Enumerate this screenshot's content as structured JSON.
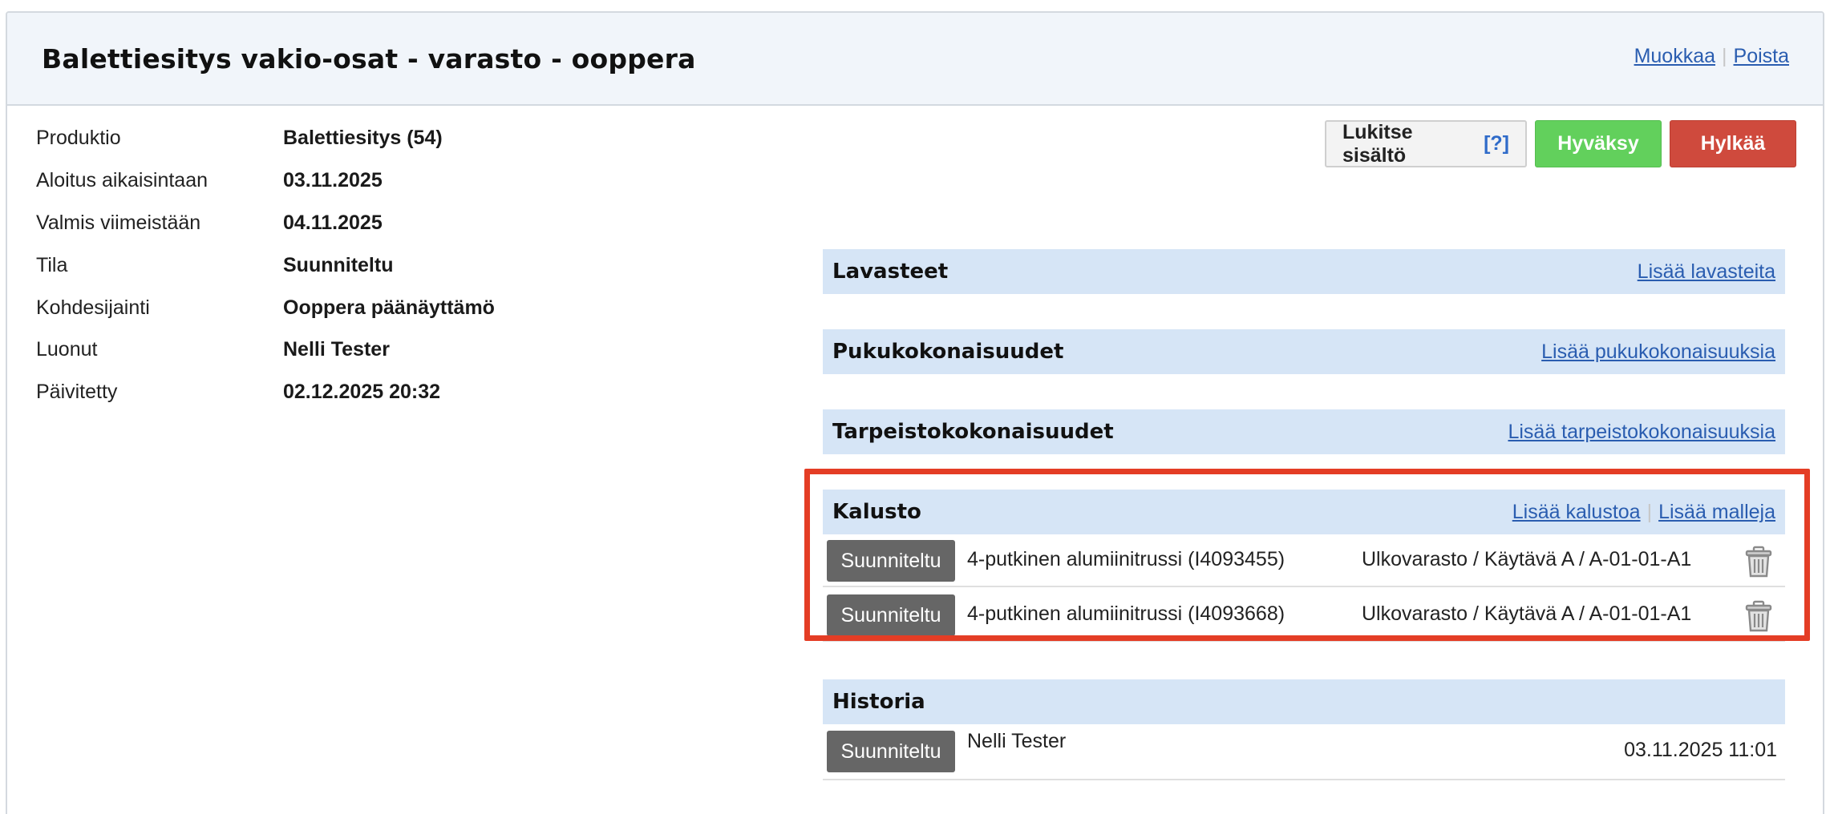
{
  "header": {
    "title": "Balettiesitys vakio-osat - varasto - ooppera",
    "edit_link": "Muokkaa",
    "delete_link": "Poista",
    "separator": "|"
  },
  "info": [
    {
      "label": "Produktio",
      "value": "Balettiesitys (54)"
    },
    {
      "label": "Aloitus aikaisintaan",
      "value": "03.11.2025"
    },
    {
      "label": "Valmis viimeistään",
      "value": "04.11.2025"
    },
    {
      "label": "Tila",
      "value": "Suunniteltu"
    },
    {
      "label": "Kohdesijainti",
      "value": "Ooppera päänäyttämö"
    },
    {
      "label": "Luonut",
      "value": "Nelli Tester"
    },
    {
      "label": "Päivitetty",
      "value": "02.12.2025 20:32"
    }
  ],
  "actions": {
    "lock_label": "Lukitse sisältö",
    "lock_help": "[?]",
    "approve_label": "Hyväksy",
    "reject_label": "Hylkää"
  },
  "sections": {
    "lavasteet": {
      "title": "Lavasteet",
      "link": "Lisää lavasteita"
    },
    "puvut": {
      "title": "Pukukokonaisuudet",
      "link": "Lisää pukukokonaisuuksia"
    },
    "tarpeisto": {
      "title": "Tarpeistokokonaisuudet",
      "link": "Lisää tarpeistokokonaisuuksia"
    },
    "kalusto": {
      "title": "Kalusto",
      "link_equipment": "Lisää kalustoa",
      "link_templates": "Lisää malleja",
      "items": [
        {
          "status": "Suunniteltu",
          "name": "4-putkinen alumiinitrussi (I4093455)",
          "location": "Ulkovarasto / Käytävä A / A-01-01-A1",
          "icon": "trash-icon"
        },
        {
          "status": "Suunniteltu",
          "name": "4-putkinen alumiinitrussi (I4093668)",
          "location": "Ulkovarasto / Käytävä A / A-01-01-A1",
          "icon": "trash-icon"
        }
      ]
    },
    "historia": {
      "title": "Historia",
      "entries": [
        {
          "status": "Suunniteltu",
          "user": "Nelli Tester",
          "time": "03.11.2025 11:01"
        }
      ]
    }
  },
  "colors": {
    "highlight": "#e43d25",
    "approve": "#62d05c",
    "reject": "#cf4a3d",
    "section_bar": "#d6e5f6",
    "badge": "#666666",
    "link": "#2a5db0"
  }
}
